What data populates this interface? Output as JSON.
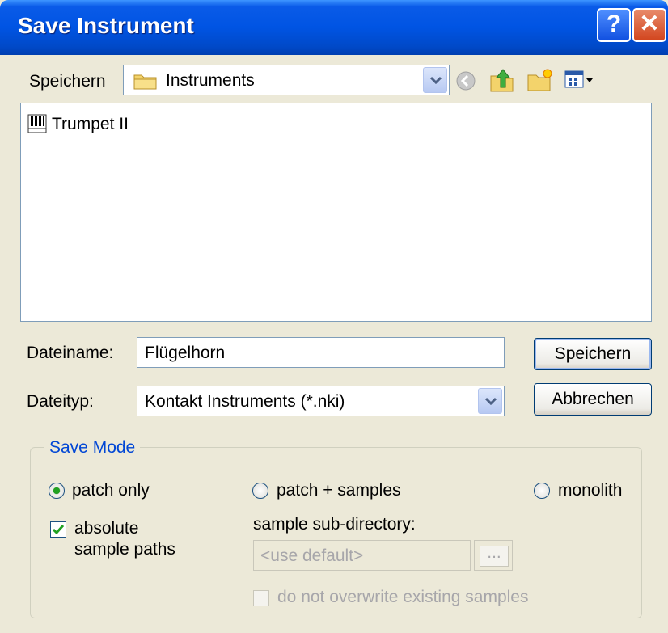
{
  "window": {
    "title": "Save Instrument",
    "help_label": "?",
    "close_label": "✕"
  },
  "location": {
    "label": "Speichern",
    "value": "Instruments"
  },
  "files": [
    {
      "name": "Trumpet II"
    }
  ],
  "filename": {
    "label": "Dateiname:",
    "value": "Flügelhorn"
  },
  "filetype": {
    "label": "Dateityp:",
    "value": "Kontakt Instruments (*.nki)"
  },
  "buttons": {
    "save": "Speichern",
    "cancel": "Abbrechen"
  },
  "save_mode": {
    "title": "Save Mode",
    "patch_only": "patch only",
    "patch_samples": "patch + samples",
    "monolith": "monolith",
    "selected": "patch only",
    "absolute_line1": "absolute",
    "absolute_line2": "sample paths",
    "absolute_checked": true,
    "subdir_label": "sample sub-directory:",
    "subdir_placeholder": "<use default>",
    "browse_label": "...",
    "no_overwrite": "do not overwrite existing samples",
    "no_overwrite_checked": false
  },
  "colors": {
    "title_bar": "#0054e3",
    "face": "#ece9d8",
    "group_title": "#0046d5",
    "radio_dot": "#21a121",
    "check": "#21a121"
  },
  "icons": [
    "help-icon",
    "close-icon",
    "folder-icon",
    "back-icon",
    "up-folder-icon",
    "new-folder-icon",
    "view-menu-icon",
    "instrument-file-icon",
    "chevron-down-icon",
    "checkmark-icon"
  ]
}
